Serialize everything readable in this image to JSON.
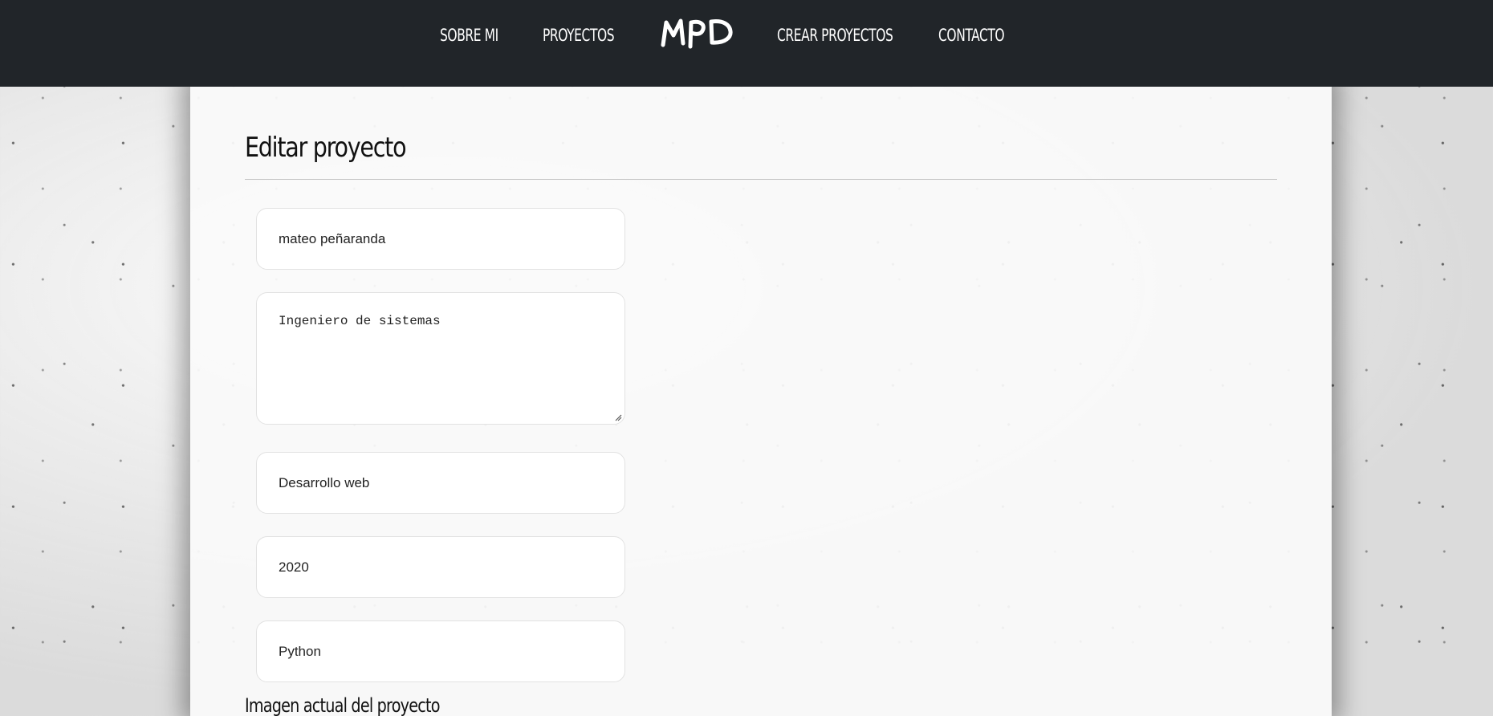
{
  "navbar": {
    "links": [
      {
        "label": "SOBRE MI"
      },
      {
        "label": "PROYECTOS"
      },
      {
        "label": "CREAR PROYECTOS"
      },
      {
        "label": "CONTACTO"
      }
    ],
    "logo": {
      "text": "MPD",
      "icon": "mpd-logo"
    }
  },
  "page": {
    "title": "Editar proyecto",
    "current_image_label": "Imagen actual del proyecto"
  },
  "form": {
    "name": "mateo peñaranda",
    "description": "Ingeniero de sistemas",
    "category": "Desarrollo web",
    "year": "2020",
    "technology": "Python"
  },
  "colors": {
    "navbar_bg": "#212529",
    "nav_text": "#ffffff",
    "card_bg": "#fafafa"
  }
}
